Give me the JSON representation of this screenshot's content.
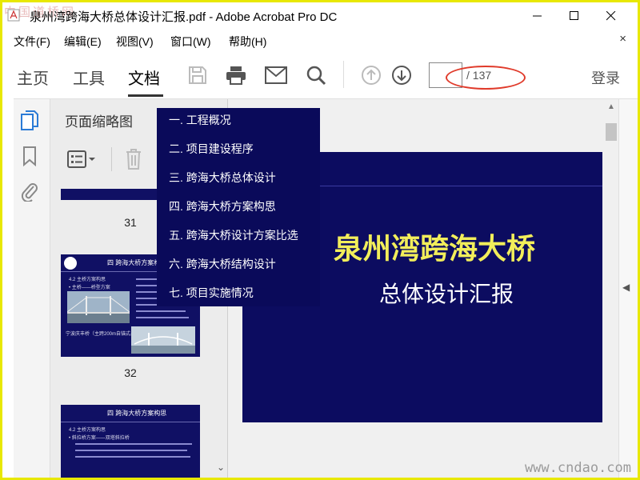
{
  "watermark_top": "中国道桥网",
  "watermark_bottom": "www.cndao.com",
  "window": {
    "title": "泉州湾跨海大桥总体设计汇报.pdf - Adobe Acrobat Pro DC"
  },
  "menu": {
    "items": [
      "文件(F)",
      "编辑(E)",
      "视图(V)",
      "窗口(W)",
      "帮助(H)"
    ],
    "close": "×"
  },
  "toolbar": {
    "tabs": [
      "主页",
      "工具",
      "文档"
    ],
    "active_tab": "文档",
    "page_current": "",
    "page_total": "/ 137",
    "login": "登录"
  },
  "thumbnails": {
    "title": "页面缩略图",
    "pages": [
      {
        "number": "31"
      },
      {
        "number": "32",
        "header": "四 跨海大桥方案构思",
        "text1": "4.2 主桥方案构思",
        "text2": "• 主桥——桥型方案",
        "caption": "宁波庆丰桥（主跨200m自锚式悬索桥）"
      },
      {
        "header": "四 跨海大桥方案构思",
        "text1": "4.2 主桥方案构思",
        "text2": "• 斜拉桥方案——双塔斜拉桥"
      }
    ]
  },
  "bookmarks": [
    "一. 工程概况",
    "二. 项目建设程序",
    "三. 跨海大桥总体设计",
    "四. 跨海大桥方案构思",
    "五. 跨海大桥设计方案比选",
    "六. 跨海大桥结构设计",
    "七. 项目实施情况"
  ],
  "slide": {
    "title": "泉州湾跨海大桥",
    "subtitle": "总体设计汇报",
    "background": "#0c0c60",
    "title_color": "#f2ee5a"
  },
  "colors": {
    "border": "#e8e803",
    "annotation": "#e03a2a"
  }
}
